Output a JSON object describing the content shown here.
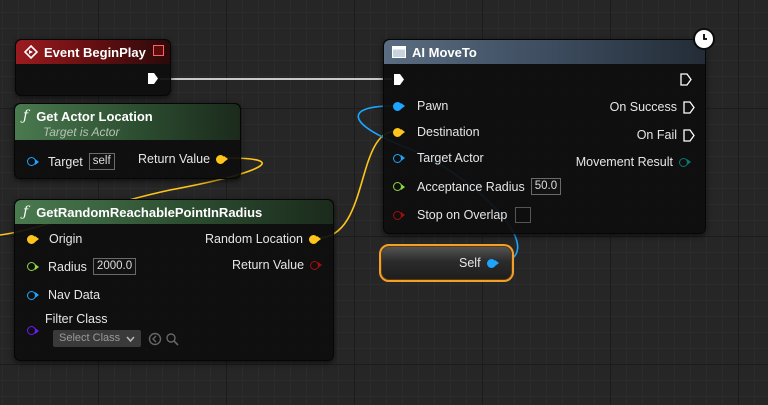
{
  "colors": {
    "exec": "#ffffff",
    "vector": "#ffc61a",
    "object": "#1da6ff",
    "float": "#8ed93e",
    "bool": "#a40d0d",
    "class": "#6a1bff",
    "enum": "#07796e",
    "self_border": "#f3a02a"
  },
  "event_begin_play": {
    "title": "Event BeginPlay"
  },
  "get_actor_location": {
    "title": "Get Actor Location",
    "subtitle": "Target is Actor",
    "target_label": "Target",
    "target_value": "self",
    "return_label": "Return Value"
  },
  "get_random_point": {
    "title": "GetRandomReachablePointInRadius",
    "origin_label": "Origin",
    "radius_label": "Radius",
    "radius_value": "2000.0",
    "nav_data_label": "Nav Data",
    "filter_class_label": "Filter Class",
    "filter_class_value": "Select Class",
    "random_location_label": "Random Location",
    "return_label": "Return Value"
  },
  "ai_move_to": {
    "title": "AI MoveTo",
    "pawn_label": "Pawn",
    "destination_label": "Destination",
    "target_actor_label": "Target Actor",
    "acceptance_radius_label": "Acceptance Radius",
    "acceptance_radius_value": "50.0",
    "stop_on_overlap_label": "Stop on Overlap",
    "on_success_label": "On Success",
    "on_fail_label": "On Fail",
    "movement_result_label": "Movement Result"
  },
  "self_node": {
    "label": "Self"
  }
}
